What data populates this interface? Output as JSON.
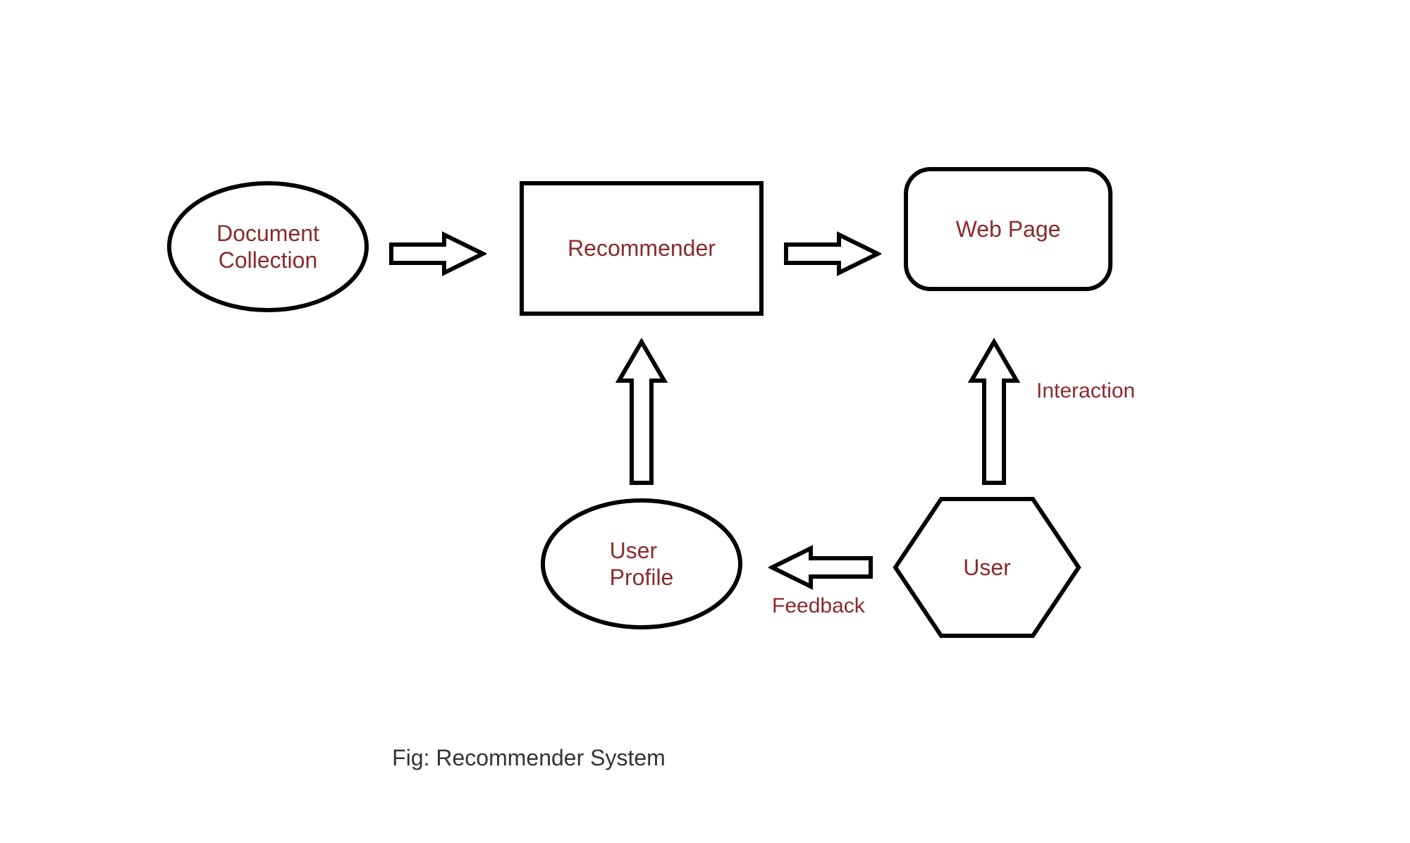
{
  "nodes": {
    "doc": {
      "label_line1": "Document",
      "label_line2": "Collection"
    },
    "recommender": {
      "label": "Recommender"
    },
    "webpage": {
      "label": "Web Page"
    },
    "userprofile": {
      "label_line1": "User",
      "label_line2": "Profile"
    },
    "user": {
      "label": "User"
    }
  },
  "edges": {
    "interaction": {
      "label": "Interaction"
    },
    "feedback": {
      "label": "Feedback"
    }
  },
  "caption": "Fig: Recommender System",
  "diagram": {
    "type": "flow-diagram",
    "nodes": [
      {
        "id": "doc",
        "shape": "ellipse",
        "text": "Document Collection"
      },
      {
        "id": "recommender",
        "shape": "rectangle",
        "text": "Recommender"
      },
      {
        "id": "webpage",
        "shape": "rounded-rectangle",
        "text": "Web Page"
      },
      {
        "id": "userprofile",
        "shape": "ellipse",
        "text": "User Profile"
      },
      {
        "id": "user",
        "shape": "hexagon",
        "text": "User"
      }
    ],
    "arrows": [
      {
        "from": "doc",
        "to": "recommender",
        "direction": "right"
      },
      {
        "from": "recommender",
        "to": "webpage",
        "direction": "right"
      },
      {
        "from": "userprofile",
        "to": "recommender",
        "direction": "up"
      },
      {
        "from": "user",
        "to": "webpage",
        "direction": "up",
        "label": "Interaction"
      },
      {
        "from": "user",
        "to": "userprofile",
        "direction": "left",
        "label": "Feedback"
      }
    ]
  }
}
